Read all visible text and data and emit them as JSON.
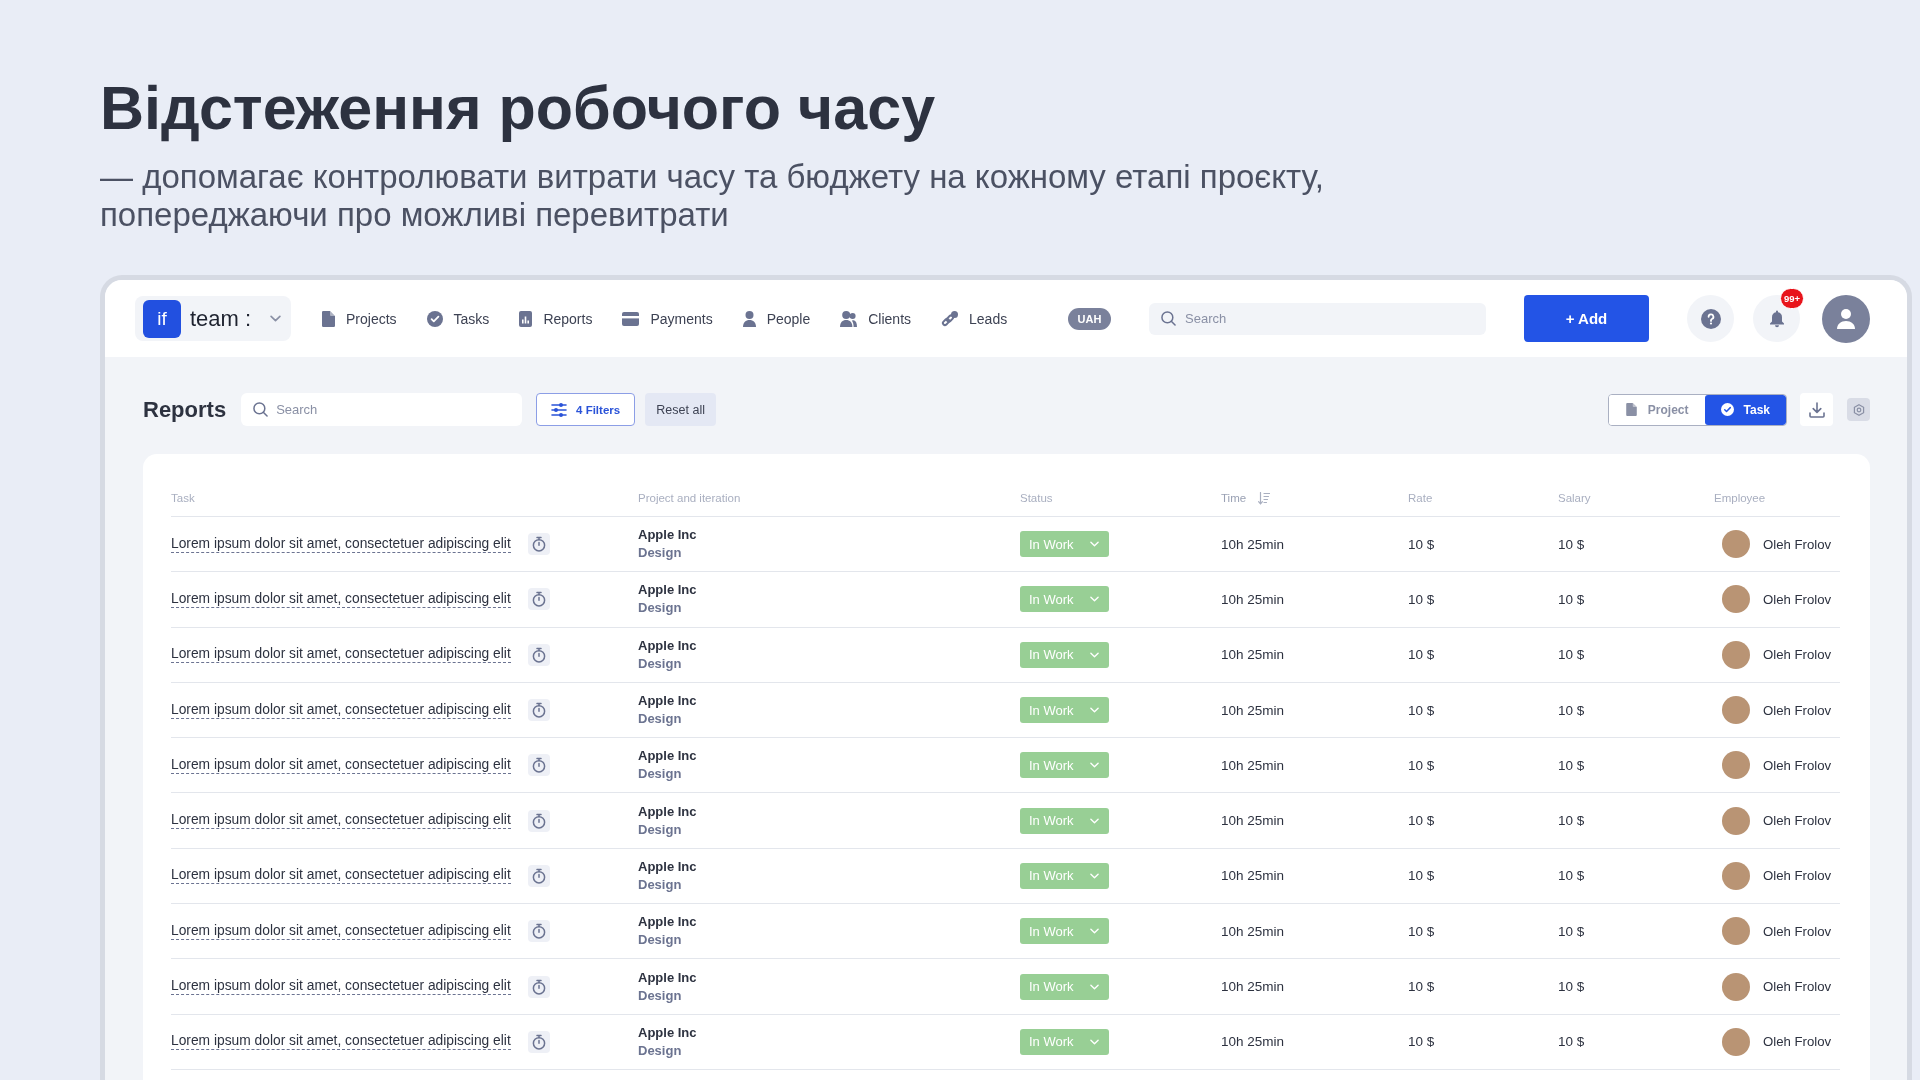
{
  "heading": {
    "title": "Відстеження робочого часу",
    "subtitle": "— допомагає контролювати витрати часу та бюджету на кожному етапі проєкту, попереджаючи про можливі перевитрати"
  },
  "topbar": {
    "brand": {
      "logo": "if",
      "name": "team :"
    },
    "nav": [
      {
        "label": "Projects"
      },
      {
        "label": "Tasks"
      },
      {
        "label": "Reports"
      },
      {
        "label": "Payments"
      },
      {
        "label": "People"
      },
      {
        "label": "Clients"
      },
      {
        "label": "Leads"
      }
    ],
    "currency": "UAH",
    "search": {
      "placeholder": "Search"
    },
    "add_button": "+ Add",
    "notifications": {
      "badge": "99+"
    }
  },
  "reports": {
    "title": "Reports",
    "search": {
      "placeholder": "Search"
    },
    "filters_button": "4 Filters",
    "reset_button": "Reset all",
    "view_toggle": [
      {
        "label": "Project",
        "selected": false
      },
      {
        "label": "Task",
        "selected": true
      }
    ]
  },
  "table": {
    "columns": [
      {
        "label": "Task",
        "sorted": false
      },
      {
        "label": "Project and iteration",
        "sorted": false
      },
      {
        "label": "Status",
        "sorted": false
      },
      {
        "label": "Time",
        "sorted": true
      },
      {
        "label": "Rate",
        "sorted": false
      },
      {
        "label": "Salary",
        "sorted": false
      },
      {
        "label": "Employee",
        "sorted": false
      }
    ],
    "rows": [
      {
        "task": "Lorem ipsum dolor sit amet, consectetuer adipiscing elit",
        "project": "Apple Inc",
        "iteration": "Design",
        "status": "In Work",
        "time": "10h 25min",
        "rate": "10 $",
        "salary": "10 $",
        "employee": "Oleh Frolov"
      },
      {
        "task": "Lorem ipsum dolor sit amet, consectetuer adipiscing elit",
        "project": "Apple Inc",
        "iteration": "Design",
        "status": "In Work",
        "time": "10h 25min",
        "rate": "10 $",
        "salary": "10 $",
        "employee": "Oleh Frolov"
      },
      {
        "task": "Lorem ipsum dolor sit amet, consectetuer adipiscing elit",
        "project": "Apple Inc",
        "iteration": "Design",
        "status": "In Work",
        "time": "10h 25min",
        "rate": "10 $",
        "salary": "10 $",
        "employee": "Oleh Frolov"
      },
      {
        "task": "Lorem ipsum dolor sit amet, consectetuer adipiscing elit",
        "project": "Apple Inc",
        "iteration": "Design",
        "status": "In Work",
        "time": "10h 25min",
        "rate": "10 $",
        "salary": "10 $",
        "employee": "Oleh Frolov"
      },
      {
        "task": "Lorem ipsum dolor sit amet, consectetuer adipiscing elit",
        "project": "Apple Inc",
        "iteration": "Design",
        "status": "In Work",
        "time": "10h 25min",
        "rate": "10 $",
        "salary": "10 $",
        "employee": "Oleh Frolov"
      },
      {
        "task": "Lorem ipsum dolor sit amet, consectetuer adipiscing elit",
        "project": "Apple Inc",
        "iteration": "Design",
        "status": "In Work",
        "time": "10h 25min",
        "rate": "10 $",
        "salary": "10 $",
        "employee": "Oleh Frolov"
      },
      {
        "task": "Lorem ipsum dolor sit amet, consectetuer adipiscing elit",
        "project": "Apple Inc",
        "iteration": "Design",
        "status": "In Work",
        "time": "10h 25min",
        "rate": "10 $",
        "salary": "10 $",
        "employee": "Oleh Frolov"
      },
      {
        "task": "Lorem ipsum dolor sit amet, consectetuer adipiscing elit",
        "project": "Apple Inc",
        "iteration": "Design",
        "status": "In Work",
        "time": "10h 25min",
        "rate": "10 $",
        "salary": "10 $",
        "employee": "Oleh Frolov"
      },
      {
        "task": "Lorem ipsum dolor sit amet, consectetuer adipiscing elit",
        "project": "Apple Inc",
        "iteration": "Design",
        "status": "In Work",
        "time": "10h 25min",
        "rate": "10 $",
        "salary": "10 $",
        "employee": "Oleh Frolov"
      },
      {
        "task": "Lorem ipsum dolor sit amet, consectetuer adipiscing elit",
        "project": "Apple Inc",
        "iteration": "Design",
        "status": "In Work",
        "time": "10h 25min",
        "rate": "10 $",
        "salary": "10 $",
        "employee": "Oleh Frolov"
      }
    ]
  }
}
